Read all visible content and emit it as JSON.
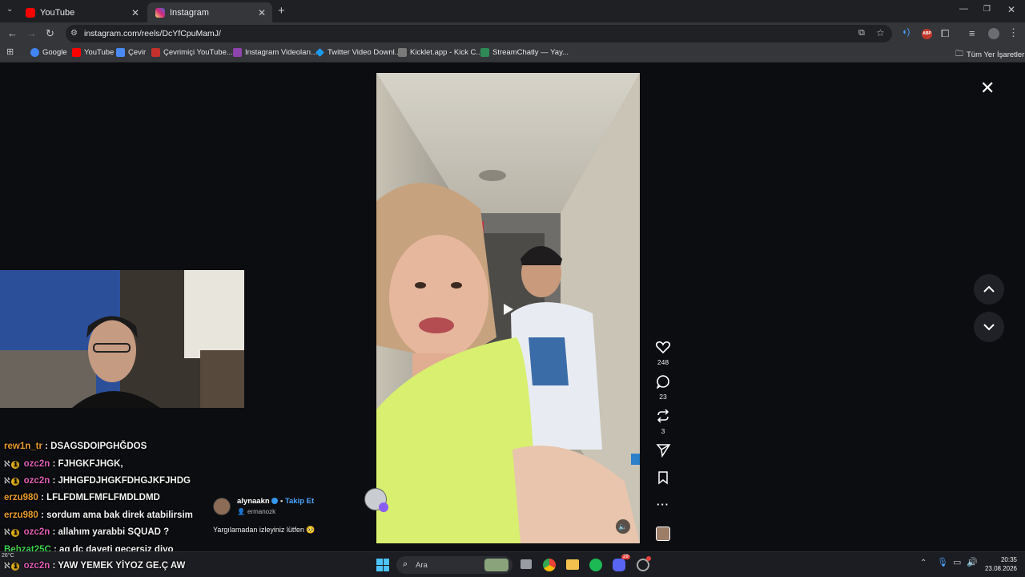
{
  "tabs": [
    {
      "title": "YouTube",
      "color": "#ff0000"
    },
    {
      "title": "Instagram",
      "color": "#d6249f"
    }
  ],
  "address": {
    "url": "instagram.com/reels/DcYfCpuMamJ/"
  },
  "bookmarks": [
    {
      "label": "Google",
      "color": "#4285f4"
    },
    {
      "label": "YouTube",
      "color": "#ff0000"
    },
    {
      "label": "Çevir",
      "color": "#4a8af4"
    },
    {
      "label": "Çevrimiçi YouTube...",
      "color": "#c4302b"
    },
    {
      "label": "Instagram Videoları...",
      "color": "#8e44ad"
    },
    {
      "label": "Twitter Video Downl...",
      "color": "#1d9bf0"
    },
    {
      "label": "Kicklet.app - Kick C...",
      "color": "#7a7a7a"
    },
    {
      "label": "StreamChatly — Yay...",
      "color": "#2e8b57"
    }
  ],
  "all_bookmarks": "Tüm Yer İşaretleri",
  "reel": {
    "author": "alynaakn",
    "follow": "Takip Et",
    "collab": "ermanozk",
    "caption": "Yargılamadan izleyiniz lütfen 🥺",
    "likes": "248",
    "comments": "23",
    "reposts": "3"
  },
  "chat": [
    {
      "user": "rew1n_tr",
      "color": "#e89b2c",
      "badge": false,
      "msg": "DSAGSDOIPGHĞDOS"
    },
    {
      "user": "ozc2n",
      "color": "#e05db5",
      "badge": true,
      "msg": "FJHGKFJHGK,"
    },
    {
      "user": "ozc2n",
      "color": "#e05db5",
      "badge": true,
      "msg": "JHHGFDJHGKFDHGJKFJHDG"
    },
    {
      "user": "erzu980",
      "color": "#e89b2c",
      "badge": false,
      "msg": "LFLFDMLFMFLFMDLDMD"
    },
    {
      "user": "erzu980",
      "color": "#e89b2c",
      "badge": false,
      "msg": "sordum ama bak direk atabilirsim"
    },
    {
      "user": "ozc2n",
      "color": "#e05db5",
      "badge": true,
      "msg": "allahım yarabbi SQUAD ?"
    },
    {
      "user": "Behzat25C",
      "color": "#3fcf4a",
      "badge": false,
      "msg": "aq dc daveti geçersiz diyo"
    },
    {
      "user": "ozc2n",
      "color": "#e05db5",
      "badge": true,
      "msg": "YAW YEMEK YİYOZ GE.Ç AW"
    }
  ],
  "taskbar": {
    "search_placeholder": "Ara",
    "weather": "26°C",
    "time": "20:35",
    "date": "23.08.2026",
    "discord_badge": "29"
  }
}
